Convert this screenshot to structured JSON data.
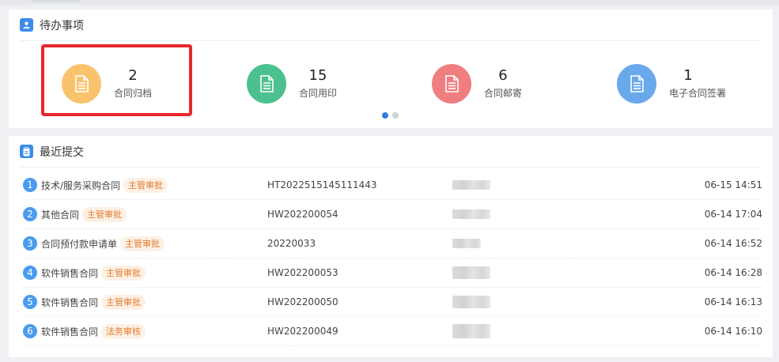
{
  "todo": {
    "title": "待办事项",
    "items": [
      {
        "count": "2",
        "label": "合同归档",
        "color": "#f9c36e"
      },
      {
        "count": "15",
        "label": "合同用印",
        "color": "#4cc08f"
      },
      {
        "count": "6",
        "label": "合同邮寄",
        "color": "#f07e80"
      },
      {
        "count": "1",
        "label": "电子合同签署",
        "color": "#6aa8ec"
      }
    ],
    "carousel": {
      "pages": 2,
      "active": 0
    }
  },
  "recent": {
    "title": "最近提交",
    "rows": [
      {
        "index": "1",
        "name": "技术/服务采购合同",
        "status": "主管审批",
        "code": "HT2022515145111443",
        "time": "06-15 14:51"
      },
      {
        "index": "2",
        "name": "其他合同",
        "status": "主管审批",
        "code": "HW202200054",
        "time": "06-14 17:04"
      },
      {
        "index": "3",
        "name": "合同预付款申请单",
        "status": "主管审批",
        "code": "20220033",
        "time": "06-14 16:52"
      },
      {
        "index": "4",
        "name": "软件销售合同",
        "status": "主管审批",
        "code": "HW202200053",
        "time": "06-14 16:28"
      },
      {
        "index": "5",
        "name": "软件销售合同",
        "status": "主管审批",
        "code": "HW202200050",
        "time": "06-14 16:13"
      },
      {
        "index": "6",
        "name": "软件销售合同",
        "status": "法务审核",
        "code": "HW202200049",
        "time": "06-14 16:10"
      }
    ]
  },
  "colors": {
    "accent": "#2f7fe0",
    "highlight": "#e8262a",
    "badge_text": "#e07a2a"
  }
}
